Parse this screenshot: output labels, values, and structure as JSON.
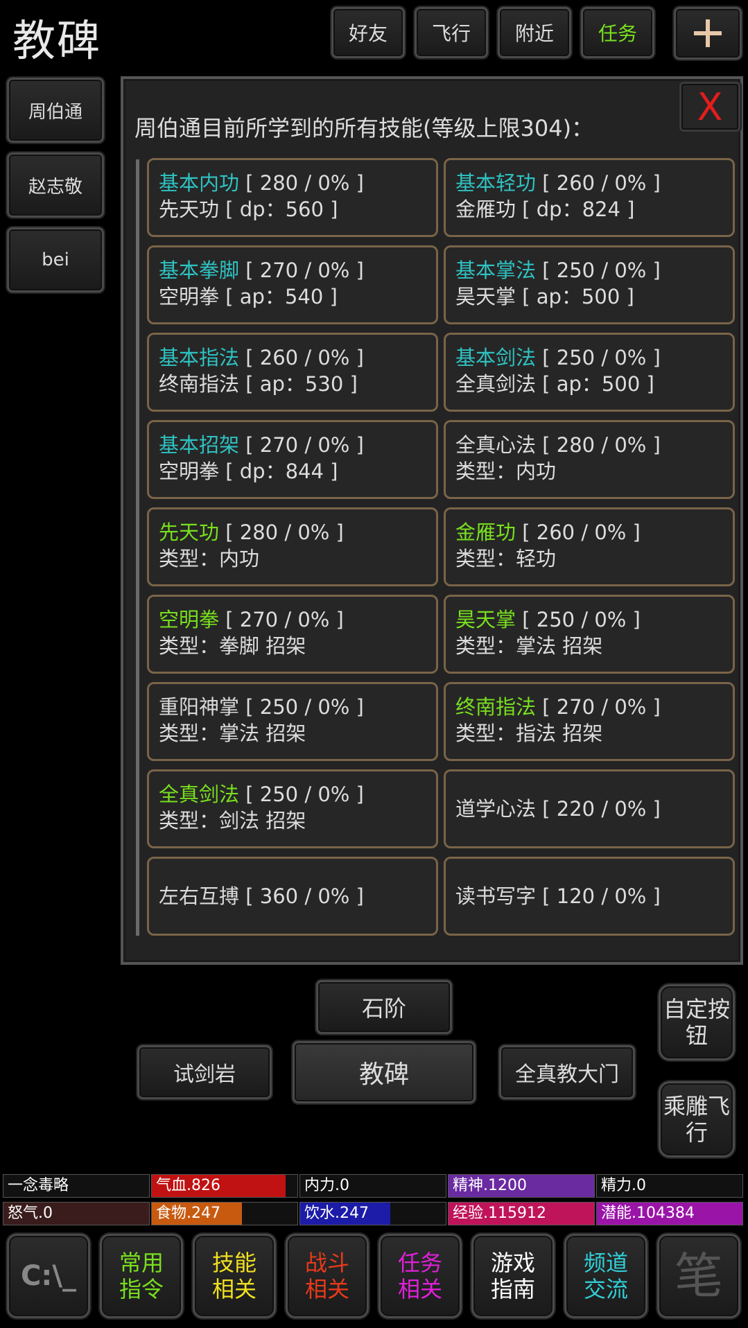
{
  "header": {
    "title": "教碑"
  },
  "top_buttons": [
    {
      "label": "好友",
      "color": "#dddddd"
    },
    {
      "label": "飞行",
      "color": "#dddddd"
    },
    {
      "label": "附近",
      "color": "#dddddd"
    },
    {
      "label": "任务",
      "color": "#78e01e"
    }
  ],
  "add_button": {
    "label": "+"
  },
  "sidebar": {
    "items": [
      {
        "label": "周伯通"
      },
      {
        "label": "赵志敬"
      },
      {
        "label": "bei"
      }
    ]
  },
  "panel": {
    "title": "周伯通目前所学到的所有技能(等级上限304)：",
    "close_label": "X",
    "skills": [
      {
        "name": "基本内功",
        "level": " [ 280 / 0% ]",
        "line2": "先天功 [ dp：560 ]",
        "color": "cyan"
      },
      {
        "name": "基本轻功",
        "level": " [ 260 / 0% ]",
        "line2": "金雁功 [ dp：824 ]",
        "color": "cyan"
      },
      {
        "name": "基本拳脚",
        "level": " [ 270 / 0% ]",
        "line2": "空明拳 [ ap：540 ]",
        "color": "cyan"
      },
      {
        "name": "基本掌法",
        "level": " [ 250 / 0% ]",
        "line2": "昊天掌 [ ap：500 ]",
        "color": "cyan"
      },
      {
        "name": "基本指法",
        "level": " [ 260 / 0% ]",
        "line2": "终南指法 [ ap：530 ]",
        "color": "cyan"
      },
      {
        "name": "基本剑法",
        "level": " [ 250 / 0% ]",
        "line2": "全真剑法 [ ap：500 ]",
        "color": "cyan"
      },
      {
        "name": "基本招架",
        "level": " [ 270 / 0% ]",
        "line2": "空明拳 [ dp：844 ]",
        "color": "cyan"
      },
      {
        "name": "全真心法",
        "level": " [ 280 / 0% ]",
        "line2": "类型：内功",
        "color": "white"
      },
      {
        "name": "先天功",
        "level": " [ 280 / 0% ]",
        "line2": "类型：内功",
        "color": "green"
      },
      {
        "name": "金雁功",
        "level": " [ 260 / 0% ]",
        "line2": "类型：轻功",
        "color": "green"
      },
      {
        "name": "空明拳",
        "level": " [ 270 / 0% ]",
        "line2": "类型：拳脚 招架",
        "color": "green"
      },
      {
        "name": "昊天掌",
        "level": " [ 250 / 0% ]",
        "line2": "类型：掌法 招架",
        "color": "green"
      },
      {
        "name": "重阳神掌",
        "level": " [ 250 / 0% ]",
        "line2": "类型：掌法 招架",
        "color": "white"
      },
      {
        "name": "终南指法",
        "level": " [ 270 / 0% ]",
        "line2": "类型：指法 招架",
        "color": "green"
      },
      {
        "name": "全真剑法",
        "level": " [ 250 / 0% ]",
        "line2": "类型：剑法 招架",
        "color": "green"
      },
      {
        "name": "道学心法",
        "level": " [ 220 / 0% ]",
        "line2": "",
        "color": "white"
      },
      {
        "name": "左右互搏",
        "level": " [ 360 / 0% ]",
        "line2": "",
        "color": "white"
      },
      {
        "name": "读书写字",
        "level": " [ 120 / 0% ]",
        "line2": "",
        "color": "white"
      }
    ]
  },
  "navigation": {
    "north": "石阶",
    "west": "试剑岩",
    "current": "教碑",
    "east": "全真教大门",
    "custom_button": "自定按钮",
    "ride_button": "乘雕飞行"
  },
  "stats": [
    {
      "label": "一念毒略",
      "fill": 0,
      "color": "#000000"
    },
    {
      "label": "气血.826",
      "fill": 0.92,
      "color": "#c01212"
    },
    {
      "label": "内力.0",
      "fill": 0,
      "color": "#000000"
    },
    {
      "label": "精神.1200",
      "fill": 1.0,
      "color": "#6a2aa0"
    },
    {
      "label": "精力.0",
      "fill": 0,
      "color": "#000000"
    },
    {
      "label": "怒气.0",
      "fill": 1.0,
      "color": "#3a1c1c"
    },
    {
      "label": "食物.247",
      "fill": 0.62,
      "color": "#c85a10"
    },
    {
      "label": "饮水.247",
      "fill": 0.62,
      "color": "#1c1ca8"
    },
    {
      "label": "经验.115912",
      "fill": 1.0,
      "color": "#c0145a"
    },
    {
      "label": "潜能.104384",
      "fill": 1.0,
      "color": "#9a14a8"
    }
  ],
  "bottom_bar": [
    {
      "label": "C:\\_",
      "color": "#888888"
    },
    {
      "label": "常用指令",
      "color": "#78e01e"
    },
    {
      "label": "技能相关",
      "color": "#f0e020"
    },
    {
      "label": "战斗相关",
      "color": "#e83a1a"
    },
    {
      "label": "任务相关",
      "color": "#e020d8"
    },
    {
      "label": "游戏指南",
      "color": "#ffffff"
    },
    {
      "label": "频道交流",
      "color": "#30d0d8"
    },
    {
      "label": "笔",
      "color": "#555555"
    }
  ]
}
